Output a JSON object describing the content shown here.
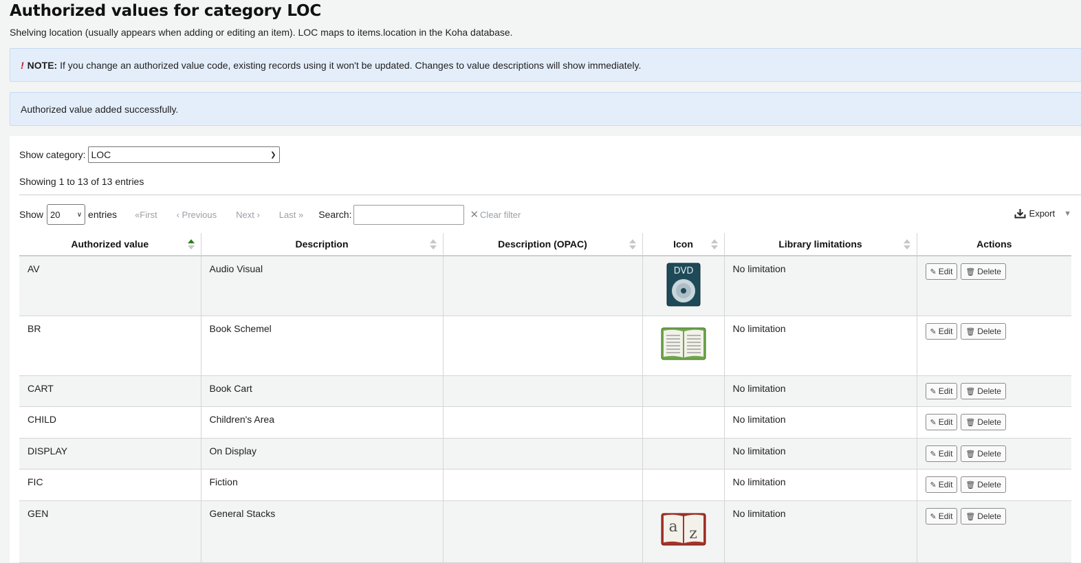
{
  "page": {
    "title": "Authorized values for category LOC",
    "subtitle": "Shelving location (usually appears when adding or editing an item). LOC maps to items.location in the Koha database."
  },
  "note": {
    "mark": "!",
    "label": "NOTE:",
    "text": " If you change an authorized value code, existing records using it won't be updated. Changes to value descriptions will show immediately."
  },
  "success_message": "Authorized value added successfully.",
  "filter": {
    "show_category_label": "Show category:",
    "category_value": "LOC"
  },
  "info": "Showing 1 to 13 of 13 entries",
  "toolbar": {
    "show_label": "Show",
    "page_length": "20",
    "entries_label": "entries",
    "first": "First",
    "previous": "Previous",
    "next": "Next",
    "last": "Last",
    "search_label": "Search:",
    "search_value": "",
    "clear_filter": "Clear filter",
    "export": "Export"
  },
  "table": {
    "columns": [
      "Authorized value",
      "Description",
      "Description (OPAC)",
      "Icon",
      "Library limitations",
      "Actions"
    ],
    "rows": [
      {
        "value": "AV",
        "description": "Audio Visual",
        "opac": "",
        "icon": "dvd-icon",
        "limits": "No limitation"
      },
      {
        "value": "BR",
        "description": "Book Schemel",
        "opac": "",
        "icon": "open-book-icon",
        "limits": "No limitation"
      },
      {
        "value": "CART",
        "description": "Book Cart",
        "opac": "",
        "icon": "",
        "limits": "No limitation"
      },
      {
        "value": "CHILD",
        "description": "Children's Area",
        "opac": "",
        "icon": "",
        "limits": "No limitation"
      },
      {
        "value": "DISPLAY",
        "description": "On Display",
        "opac": "",
        "icon": "",
        "limits": "No limitation"
      },
      {
        "value": "FIC",
        "description": "Fiction",
        "opac": "",
        "icon": "",
        "limits": "No limitation"
      },
      {
        "value": "GEN",
        "description": "General Stacks",
        "opac": "",
        "icon": "dictionary-icon",
        "limits": "No limitation"
      }
    ],
    "edit_label": "Edit",
    "delete_label": "Delete"
  },
  "colors": {
    "alert_bg": "#e4eefb",
    "sort_active": "#2f7d1f",
    "note_mark": "#c4161c"
  }
}
